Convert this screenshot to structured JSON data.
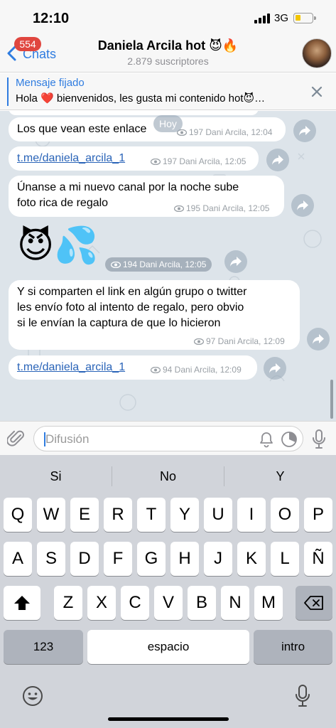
{
  "status": {
    "time": "12:10",
    "network": "3G"
  },
  "nav": {
    "back_label": "Chats",
    "unread_badge": "554",
    "title": "Daniela Arcila hot 😈🔥",
    "subscribers": "2.879 suscriptores"
  },
  "pinned": {
    "title": "Mensaje fijado",
    "text": "Hola ❤️ bienvenidos, les gusta mi contenido hot😈…"
  },
  "chat": {
    "date_pill": "Hoy",
    "messages": [
      {
        "text": "Los que vean este enlace",
        "meta": "197 Dani Arcila, 12:04"
      },
      {
        "text": "t.me/daniela_arcila_1",
        "meta": "197 Dani Arcila, 12:05"
      },
      {
        "line1": "Únanse a mi nuevo canal por la noche sube",
        "line2": "foto rica de regalo",
        "meta": "195 Dani Arcila, 12:05"
      },
      {
        "emoji": "😈💦",
        "meta": "194 Dani Arcila, 12:05"
      },
      {
        "line1": "Y si comparten el link en algún grupo o twitter",
        "line2": "les envío foto al intento de regalo, pero obvio",
        "line3": "si le envían la captura de que lo hicieron",
        "meta": "97 Dani Arcila, 12:09"
      },
      {
        "text": "t.me/daniela_arcila_1",
        "meta": "94 Dani Arcila, 12:09"
      }
    ]
  },
  "composer": {
    "placeholder": "Difusión"
  },
  "keyboard": {
    "suggestions": [
      "Si",
      "No",
      "Y"
    ],
    "row1": [
      "Q",
      "W",
      "E",
      "R",
      "T",
      "Y",
      "U",
      "I",
      "O",
      "P"
    ],
    "row2": [
      "A",
      "S",
      "D",
      "F",
      "G",
      "H",
      "J",
      "K",
      "L",
      "Ñ"
    ],
    "row3": [
      "Z",
      "X",
      "C",
      "V",
      "B",
      "N",
      "M"
    ],
    "numbers_label": "123",
    "space_label": "espacio",
    "return_label": "intro"
  },
  "colors": {
    "accent": "#2f7ce0",
    "badge": "#e0463f",
    "chat_bg": "#dde4ea"
  }
}
